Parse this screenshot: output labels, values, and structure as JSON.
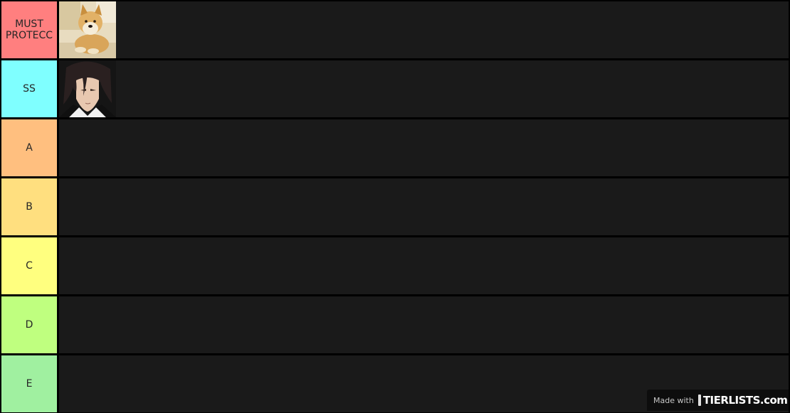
{
  "tiers": [
    {
      "label": "MUST PROTECC",
      "color": "#ff7f7f",
      "items": [
        "doge-image"
      ]
    },
    {
      "label": "SS",
      "color": "#7fffff",
      "items": [
        "anime-character-image"
      ]
    },
    {
      "label": "A",
      "color": "#ffbf7f",
      "items": []
    },
    {
      "label": "B",
      "color": "#ffdf7f",
      "items": []
    },
    {
      "label": "C",
      "color": "#ffff7f",
      "items": []
    },
    {
      "label": "D",
      "color": "#bfff7f",
      "items": []
    },
    {
      "label": "E",
      "color": "#a0f0a0",
      "items": []
    }
  ],
  "watermark": {
    "prefix": "Made with",
    "brand": "TIERLISTS.com"
  },
  "colors": {
    "background": "#000000",
    "row_background": "#1a1a1a",
    "label_text": "#262626"
  }
}
